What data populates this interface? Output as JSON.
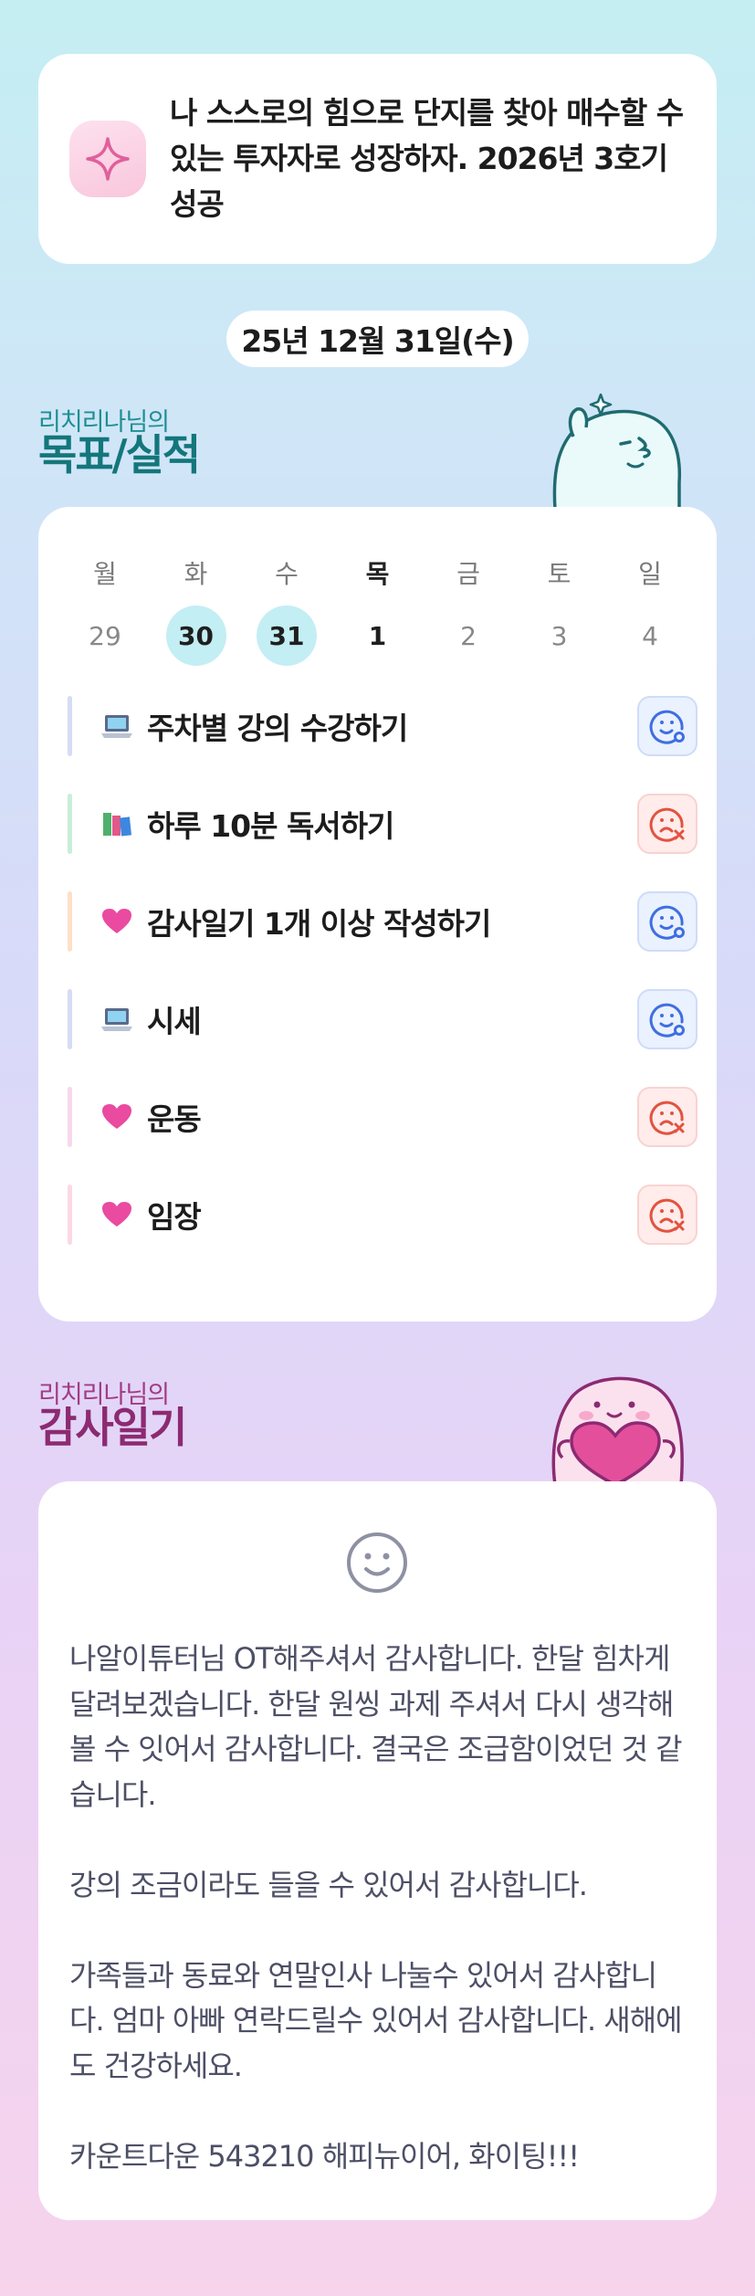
{
  "goal": {
    "text": "나 스스로의 힘으로 단지를 찾아 매수할 수 있는 투자자로 성장하자. 2026년 3호기성공",
    "icon": "sparkle-icon"
  },
  "date_label": "25년 12월 31일(수)",
  "goals_section": {
    "subtitle": "리치리나님의",
    "title": "목표/실적"
  },
  "week": {
    "days": [
      "월",
      "화",
      "수",
      "목",
      "금",
      "토",
      "일"
    ],
    "dates": [
      "29",
      "30",
      "31",
      "1",
      "2",
      "3",
      "4"
    ]
  },
  "tasks": [
    {
      "label": "주차별 강의 수강하기",
      "icon": "laptop-icon",
      "status": "done",
      "bar_color": "#d5dcf5"
    },
    {
      "label": "하루 10분 독서하기",
      "icon": "books-icon",
      "status": "fail",
      "bar_color": "#c9eedb"
    },
    {
      "label": "감사일기 1개 이상 작성하기",
      "icon": "heart-icon",
      "status": "done",
      "bar_color": "#fde0c8"
    },
    {
      "label": "시세",
      "icon": "laptop-icon",
      "status": "done",
      "bar_color": "#d5dcf5"
    },
    {
      "label": "운동",
      "icon": "heart-icon",
      "status": "fail",
      "bar_color": "#f8d7ec"
    },
    {
      "label": "임장",
      "icon": "heart-icon",
      "status": "fail",
      "bar_color": "#fbd9e3"
    }
  ],
  "diary_section": {
    "subtitle": "리치리나님의",
    "title": "감사일기"
  },
  "diary": {
    "text": "나알이튜터님 OT해주셔서 감사합니다. 한달 힘차게 달려보겠습니다. 한달 원씽 과제 주셔서 다시 생각해 볼 수 잇어서 감사합니다. 결국은 조급함이었던 것 같습니다.\n\n강의 조금이라도 들을 수 있어서 감사합니다.\n\n가족들과 동료와 연말인사 나눌수 있어서 감사합니다. 엄마 아빠 연락드릴수 있어서 감사합니다. 새해에도 건강하세요.\n\n카운트다운 543210 해피뉴이어, 화이팅!!!"
  },
  "colors": {
    "goal_teal": "#13767b",
    "diary_magenta": "#8c2a72",
    "highlight_date": "#c3eef4",
    "done_blue": "#3f6fe0",
    "fail_red": "#e2533f"
  }
}
